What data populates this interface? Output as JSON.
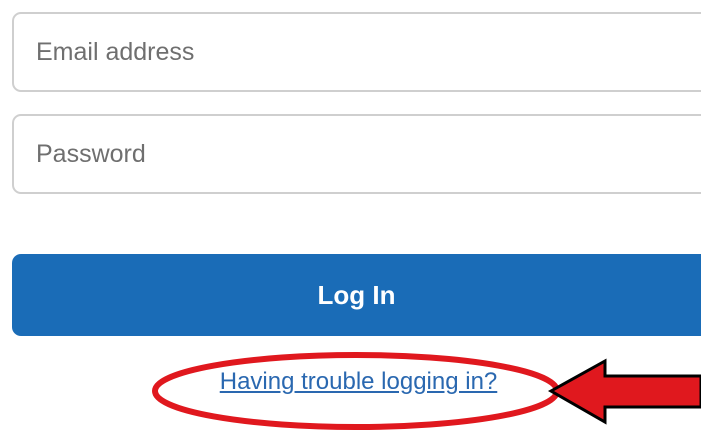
{
  "form": {
    "email": {
      "placeholder": "Email address",
      "value": ""
    },
    "password": {
      "placeholder": "Password",
      "value": ""
    },
    "login_label": "Log In",
    "trouble_link": "Having trouble logging in?"
  },
  "colors": {
    "primary_button": "#1a6cb7",
    "link": "#2a68b0",
    "annotation": "#e0181e"
  },
  "annotation": {
    "shapes": [
      "ellipse-highlight",
      "arrow-pointer"
    ]
  }
}
